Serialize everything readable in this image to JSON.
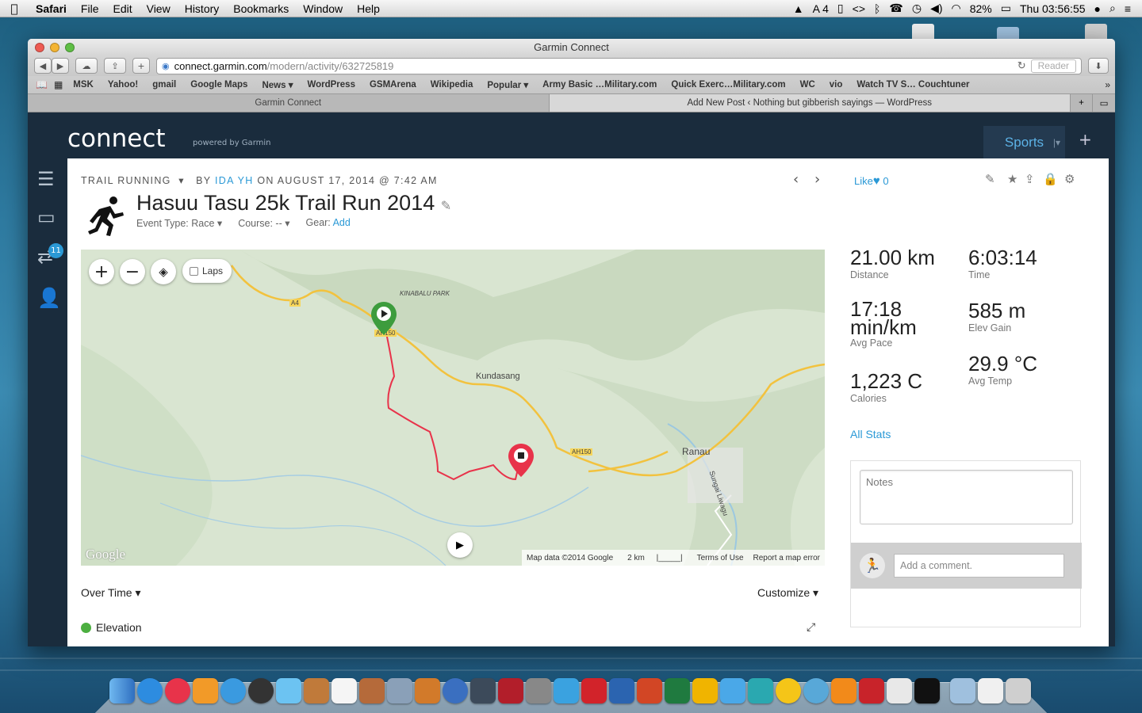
{
  "menubar": {
    "app": "Safari",
    "items": [
      "File",
      "Edit",
      "View",
      "History",
      "Bookmarks",
      "Window",
      "Help"
    ],
    "status": {
      "adobe_badge": "4",
      "battery": "82%",
      "clock": "Thu 03:56:55"
    }
  },
  "browser": {
    "window_title": "Garmin Connect",
    "url_host": "connect.garmin.com",
    "url_path": "/modern/activity/632725819",
    "reader_label": "Reader",
    "bookmarks": [
      "MSK",
      "Yahoo!",
      "gmail",
      "Google Maps",
      "News ▾",
      "WordPress",
      "GSMArena",
      "Wikipedia",
      "Popular ▾",
      "Army Basic …Military.com",
      "Quick Exerc…Military.com",
      "WC",
      "vio",
      "Watch TV S… Couchtuner"
    ],
    "tabs": [
      "Garmin Connect",
      "Add New Post ‹ Nothing but gibberish sayings — WordPress"
    ]
  },
  "garmin": {
    "logo": "connect",
    "logo_sub": "powered by Garmin",
    "sports_label": "Sports",
    "notifications_count": "11"
  },
  "activity": {
    "type": "TRAIL RUNNING",
    "by_label": "BY",
    "author": "IDA YH",
    "on_label": "ON",
    "date": "AUGUST 17, 2014 @ 7:42 AM",
    "title": "Hasuu Tasu 25k Trail Run 2014",
    "event_type": "Event Type: Race ▾",
    "course": "Course: -- ▾",
    "gear_label": "Gear:",
    "gear_action": "Add",
    "like_label": "Like",
    "like_count": "0"
  },
  "map": {
    "laps_label": "Laps",
    "places": {
      "park": "KINABALU PARK",
      "kundasang": "Kundasang",
      "ranau": "Ranau",
      "river": "Sungai Liwagu"
    },
    "roads": {
      "a4": "A4",
      "ah150a": "AH150",
      "ah150b": "AH150"
    },
    "google": "Google",
    "footer": [
      "Map data ©2014 Google",
      "2 km",
      "Terms of Use",
      "Report a map error"
    ]
  },
  "stats": {
    "distance": {
      "value": "21.00 km",
      "label": "Distance"
    },
    "time": {
      "value": "6:03:14",
      "label": "Time"
    },
    "pace": {
      "value": "17:18 min/km",
      "label": "Avg Pace"
    },
    "elev_gain": {
      "value": "585 m",
      "label": "Elev Gain"
    },
    "calories": {
      "value": "1,223 C",
      "label": "Calories"
    },
    "temp": {
      "value": "29.9 °C",
      "label": "Avg Temp"
    },
    "all_stats": "All Stats"
  },
  "notes": {
    "placeholder": "Notes",
    "comment_placeholder": "Add a comment."
  },
  "charts": {
    "over_time": "Over Time ▾",
    "customize": "Customize ▾",
    "elevation": "Elevation"
  },
  "colors": {
    "navy": "#1a2c3d",
    "accent": "#2b99d6",
    "route": "#e8334a",
    "start": "#3d9c3d"
  }
}
